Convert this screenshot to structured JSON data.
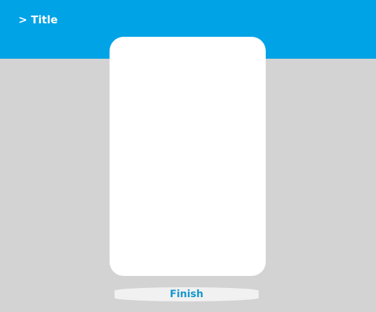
{
  "header": {
    "title": "> Title"
  },
  "actions": {
    "finish_label": "Finish"
  },
  "colors": {
    "header_background": "#00a3e6",
    "page_background": "#d3d3d3",
    "card_background": "#ffffff",
    "button_background": "#f1f1f1",
    "button_text": "#1596d0"
  }
}
